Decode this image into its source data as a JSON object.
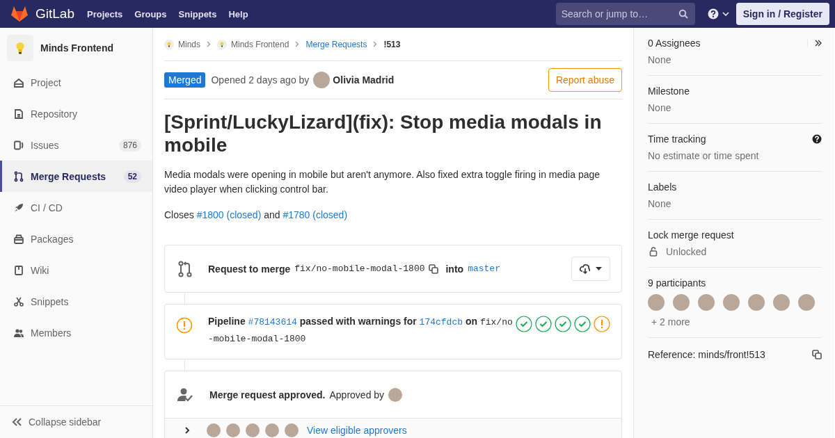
{
  "header": {
    "logo_text": "GitLab",
    "nav": [
      "Projects",
      "Groups",
      "Snippets",
      "Help"
    ],
    "search": {
      "placeholder": "Search or jump to…"
    },
    "sign_in": "Sign in / Register"
  },
  "sidebar": {
    "project_name": "Minds Frontend",
    "items": [
      {
        "label": "Project",
        "selected": false
      },
      {
        "label": "Repository",
        "selected": false
      },
      {
        "label": "Issues",
        "count": "876",
        "selected": false
      },
      {
        "label": "Merge Requests",
        "count": "52",
        "selected": true
      },
      {
        "label": "CI / CD",
        "selected": false
      },
      {
        "label": "Packages",
        "selected": false
      },
      {
        "label": "Wiki",
        "selected": false
      },
      {
        "label": "Snippets",
        "selected": false
      },
      {
        "label": "Members",
        "selected": false
      }
    ],
    "collapse": "Collapse sidebar"
  },
  "breadcrumbs": [
    {
      "label": "Minds",
      "kind": "project"
    },
    {
      "label": "Minds Frontend",
      "kind": "project"
    },
    {
      "label": "Merge Requests",
      "kind": "link"
    },
    {
      "label": "!513",
      "kind": "current"
    }
  ],
  "mr": {
    "status": "Merged",
    "opened": "Opened 2 days ago by",
    "author": "Olivia Madrid",
    "report": "Report abuse",
    "title": "[Sprint/LuckyLizard](fix): Stop media modals in mobile",
    "description": "Media modals were opening in mobile but aren't anymore. Also fixed extra toggle firing in media page video player when clicking control bar.",
    "closes": [
      {
        "text": "Closes",
        "kind": "text"
      },
      {
        "text": "#1800 (closed)",
        "kind": "link"
      },
      {
        "text": "and",
        "kind": "text"
      },
      {
        "text": "#1780 (closed)",
        "kind": "link"
      }
    ]
  },
  "merge_widget": {
    "label": "Request to merge",
    "source": "fix/no-mobile-modal-1800",
    "into": "into",
    "target": "master"
  },
  "pipeline": {
    "label": "Pipeline",
    "id": "#78143614",
    "status_text": "passed with warnings for",
    "commit": "174cfdcb",
    "on": "on",
    "branch": "fix/no-mobile-modal-1800",
    "stages": [
      {
        "kind": "success"
      },
      {
        "kind": "success"
      },
      {
        "kind": "success"
      },
      {
        "kind": "success"
      },
      {
        "kind": "warning"
      }
    ]
  },
  "approval": {
    "title": "Merge request approved.",
    "approved_by": "Approved by",
    "approvers": [
      {
        "kind": "photo"
      }
    ],
    "eligible": [
      {
        "kind": "photo"
      },
      {
        "kind": "photo"
      },
      {
        "kind": "photo"
      },
      {
        "kind": "photo"
      },
      {
        "kind": "photo"
      }
    ],
    "link": "View eligible approvers"
  },
  "right_sidebar": {
    "sections": [
      {
        "title": "0 Assignees",
        "value": "None",
        "kind": "assignees"
      },
      {
        "title": "Milestone",
        "value": "None",
        "kind": "plain"
      },
      {
        "title": "Time tracking",
        "value": "No estimate or time spent",
        "kind": "help"
      },
      {
        "title": "Labels",
        "value": "None",
        "kind": "plain"
      },
      {
        "title": "Lock merge request",
        "value": "Unlocked",
        "kind": "lock"
      },
      {
        "title": "9 participants",
        "kind": "participants",
        "avatars": [
          {
            "kind": "photo"
          },
          {
            "kind": "photo"
          },
          {
            "kind": "photo"
          },
          {
            "kind": "photo"
          },
          {
            "kind": "photo"
          },
          {
            "kind": "photo"
          },
          {
            "kind": "photo"
          }
        ],
        "more": "+ 2 more"
      },
      {
        "title": "Reference: minds/front!513",
        "kind": "reference"
      }
    ]
  }
}
